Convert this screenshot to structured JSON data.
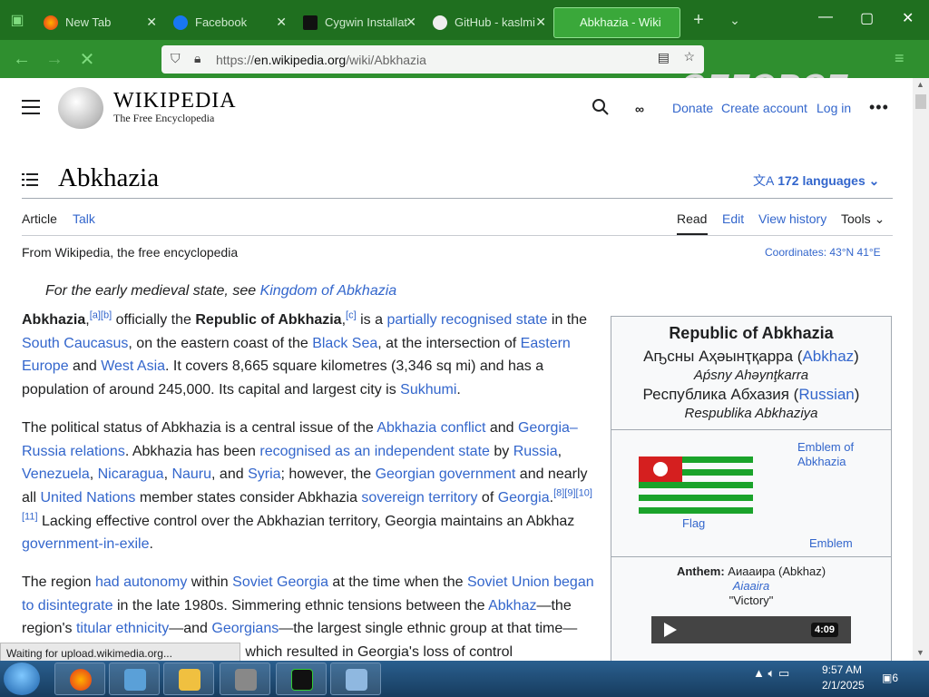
{
  "browser": {
    "tabs": [
      {
        "label": "New Tab",
        "icon": "firefox-icon"
      },
      {
        "label": "Facebook",
        "icon": "facebook-icon"
      },
      {
        "label": "Cygwin Installat",
        "icon": "cygwin-icon"
      },
      {
        "label": "GitHub - kaslmi",
        "icon": "github-icon"
      },
      {
        "label": "Abkhazia - Wiki",
        "icon": "wikipedia-icon"
      }
    ],
    "url_prefix": "https://",
    "url_domain": "en.wikipedia.org",
    "url_path": "/wiki/Abkhazia",
    "overlay_logo": "GEFORCE",
    "status": "Waiting for upload.wikimedia.org..."
  },
  "wiki": {
    "logo_word": "WIKIPEDIA",
    "logo_tag": "The Free Encyclopedia",
    "donate": "Donate",
    "create_account": "Create account",
    "login": "Log in",
    "title": "Abkhazia",
    "languages": "172 languages",
    "tab_article": "Article",
    "tab_talk": "Talk",
    "tab_read": "Read",
    "tab_edit": "Edit",
    "tab_history": "View history",
    "tab_tools": "Tools",
    "from": "From Wikipedia, the free encyclopedia",
    "coords_label": "Coordinates:",
    "coords_value": "43°N 41°E",
    "hatnote_prefix": "For the early medieval state, see ",
    "hatnote_link": "Kingdom of Abkhazia"
  },
  "infobox": {
    "title": "Republic of Abkhazia",
    "native1_a": "Аҧсны Аҳәынҭқарра (",
    "native1_link": "Abkhaz",
    "native1_b": ")",
    "native1_translit": "Aṕsny Ahəynţkarra",
    "native2_a": "Республика Абхазия (",
    "native2_link": "Russian",
    "native2_b": ")",
    "native2_translit": "Respublika Abkhaziya",
    "flag_caption": "Flag",
    "emblem_link": "Emblem of Abkhazia",
    "emblem_caption": "Emblem",
    "anthem_label": "Anthem:",
    "anthem_name": "Аиааира (Abkhaz)",
    "anthem_translit": "Aiaaira",
    "anthem_english": "\"Victory\"",
    "duration": "4:09"
  },
  "taskbar": {
    "time": "9:57 AM",
    "date": "2/1/2025",
    "notifications": "6"
  },
  "colors": {
    "link": "#3366cc",
    "chrome": "#1f6f1f"
  }
}
